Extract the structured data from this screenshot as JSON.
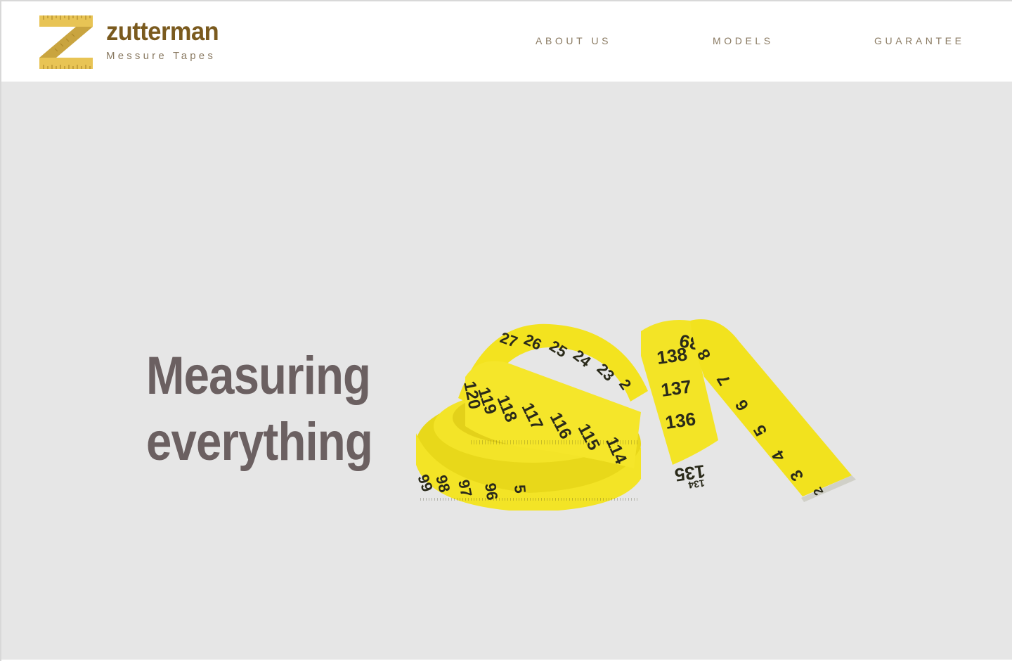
{
  "colors": {
    "brand_dark": "#7a5a1e",
    "logo_yellow": "#e8c455",
    "logo_shadow": "#c9a43f",
    "nav_text": "#8a7a62",
    "hero_bg": "#e6e6e6",
    "heading_text": "#6b6061",
    "tape_yellow": "#f2e21e",
    "tape_ink": "#2a2a1a"
  },
  "header": {
    "logo_icon": "measuring-tape-z-icon",
    "brand_name": "zutterman",
    "tagline": "Messure Tapes",
    "nav": [
      {
        "label": "ABOUT US"
      },
      {
        "label": "MODELS"
      },
      {
        "label": "GUARANTEE"
      }
    ]
  },
  "hero": {
    "heading_line1": "Measuring",
    "heading_line2": "everything",
    "image": {
      "subject": "measuring-tape-image",
      "inner_coil_numbers": [
        "99",
        "98",
        "97",
        "96",
        "5"
      ],
      "upper_loop_numbers": [
        "27",
        "26",
        "25",
        "24",
        "23",
        "2"
      ],
      "middle_band_numbers": [
        "120",
        "119",
        "118",
        "117",
        "116",
        "115",
        "114"
      ],
      "right_loop_numbers": [
        "139",
        "138",
        "137",
        "136",
        "135",
        "134"
      ],
      "tail_numbers": [
        "8",
        "7",
        "6",
        "5",
        "4",
        "3",
        "2"
      ]
    }
  }
}
